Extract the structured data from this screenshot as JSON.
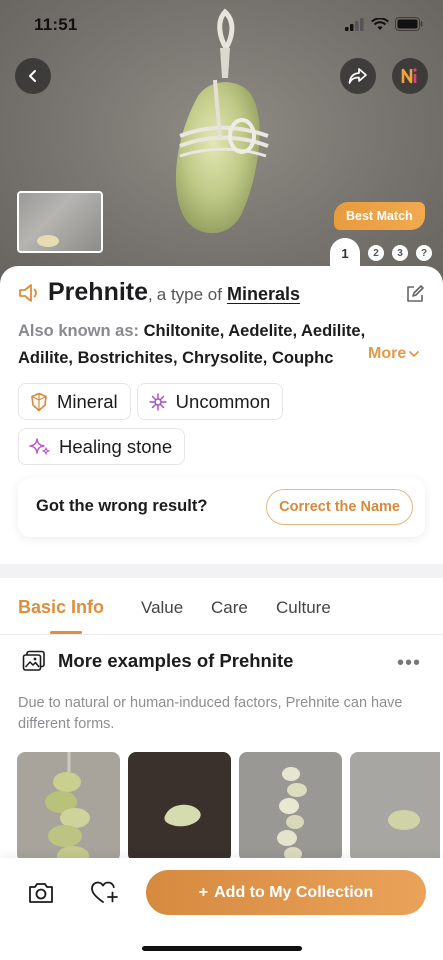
{
  "status_bar": {
    "time": "11:51"
  },
  "hero": {
    "best_match_label": "Best Match",
    "pager": {
      "active": "1",
      "pages": [
        "2",
        "3",
        "?"
      ]
    }
  },
  "identification": {
    "name": "Prehnite",
    "comma": ",",
    "type_of": "a type of",
    "category": "Minerals",
    "also_known_label": "Also known as:",
    "also_known_line1": "Chiltonite, Aedelite, Aedilite,",
    "also_known_line2": "Adilite, Bostrichites, Chrysolite, Couphc",
    "more_label": "More",
    "tags": [
      {
        "label": "Mineral",
        "icon": "crystal-shield-icon"
      },
      {
        "label": "Uncommon",
        "icon": "sparkle-star-icon"
      },
      {
        "label": "Healing stone",
        "icon": "twin-sparkle-icon"
      }
    ],
    "wrong_result_text": "Got the wrong result?",
    "correct_name_label": "Correct the Name"
  },
  "tabs": [
    {
      "label": "Basic Info",
      "active": true
    },
    {
      "label": "Value",
      "active": false
    },
    {
      "label": "Care",
      "active": false
    },
    {
      "label": "Culture",
      "active": false
    }
  ],
  "examples": {
    "title": "More examples of Prehnite",
    "description": "Due to natural or human-induced factors, Prehnite can have different forms."
  },
  "bottom_bar": {
    "add_button_label": "Add to My Collection",
    "add_button_plus": "+"
  },
  "colors": {
    "accent": "#e08d3c",
    "best_match": "#e89b3e",
    "add_button": "#d58a3f"
  }
}
